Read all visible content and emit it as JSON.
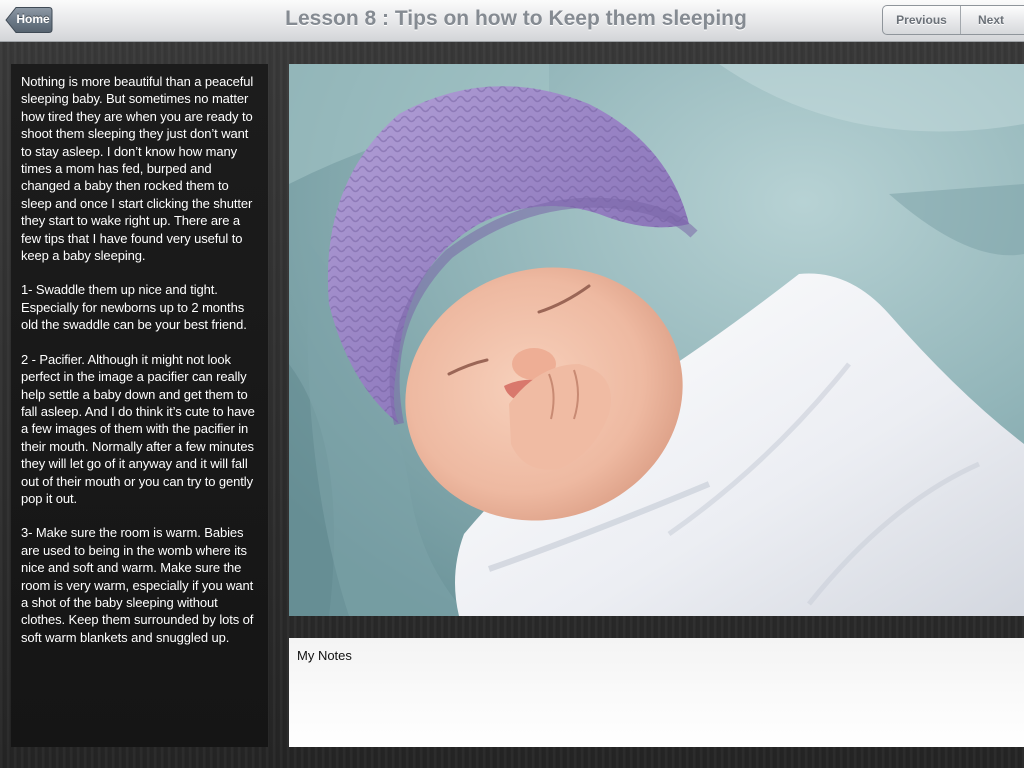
{
  "toolbar": {
    "home_label": "Home",
    "title": "Lesson 8 : Tips on how to Keep them sleeping",
    "previous_label": "Previous",
    "next_label": "Next"
  },
  "lesson": {
    "paragraphs": [
      "Nothing is more beautiful than a peaceful sleeping baby.  But sometimes no matter how tired they are when you are ready to shoot them sleeping they just don’t want to stay asleep.  I don’t know how many times a mom has fed, burped and changed a baby then rocked them to sleep and once I start clicking the shutter they start to wake right up.  There are a few tips that I have found very useful to keep a baby sleeping.",
      "1-  Swaddle them up nice and tight. Especially for newborns up to 2 months old the swaddle can be your best friend.",
      "2 - Pacifier.  Although it might not look perfect in the image a pacifier can really help settle a baby down and get them to fall asleep.  And I do think it’s cute to have a few images of them with the pacifier in their mouth. Normally after a few minutes they will let go of it anyway and it will fall out of their mouth or you can try to gently pop it out.",
      "3-  Make sure the room is warm. Babies are used to being in the womb where its nice and soft and warm. Make sure the room is very warm, especially if you want a shot of the baby sleeping without clothes.  Keep them surrounded by lots of soft warm blankets and snuggled up."
    ]
  },
  "photo": {
    "icon": "sleeping-baby-photo",
    "colors": {
      "background": "#8fb2b6",
      "hat": "#9b86c4",
      "skin": "#f1c3ad",
      "blanket": "#eef0f4"
    }
  },
  "notes": {
    "label": "My Notes"
  }
}
